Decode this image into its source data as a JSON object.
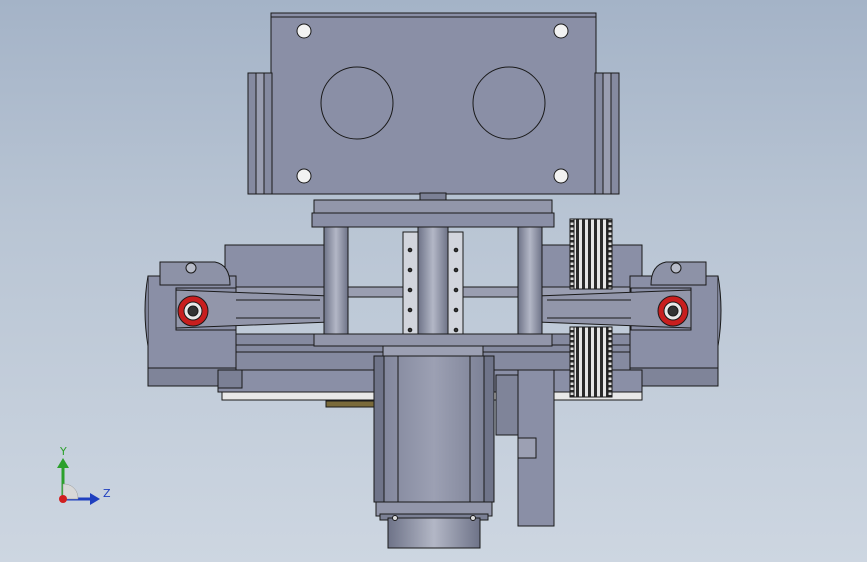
{
  "viewport": {
    "background_top": "#a4b3c7",
    "background_bottom": "#cdd6e1"
  },
  "model": {
    "metal_color": "#8a8fa6",
    "metal_dark": "#6f7489",
    "metal_light": "#a7abbd",
    "bushing_color": "#c81e1e",
    "outline_color": "#1a1a1a"
  },
  "triad": {
    "y_label": "Y",
    "z_label": "Z",
    "y_color": "#2ca02c",
    "z_color": "#1f3fbf",
    "x_color": "#d11f1f"
  }
}
